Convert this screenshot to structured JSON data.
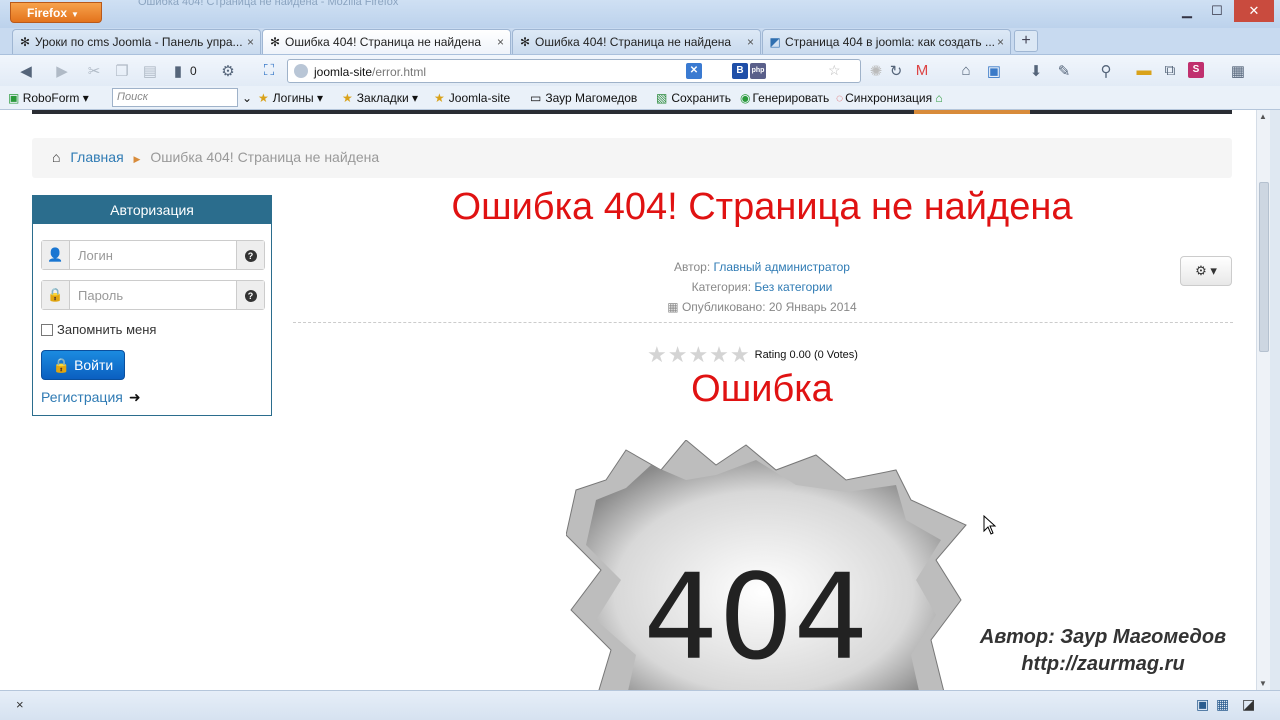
{
  "browser": {
    "menu_label": "Firefox",
    "ghost_title": "Ошибка 404! Страница не найдена - Mozilla Firefox",
    "tabs": [
      {
        "label": "Уроки по cms Joomla - Панель упра...",
        "active": false
      },
      {
        "label": "Ошибка 404! Страница не найдена",
        "active": true
      },
      {
        "label": "Ошибка 404! Страница не найдена",
        "active": false
      },
      {
        "label": "Страница 404 в joomla: как создать ...",
        "active": false
      }
    ],
    "new_tab": "+",
    "counter": "0",
    "url_host": "joomla-site",
    "url_path": "/error.html"
  },
  "bookmarks": {
    "roboform": "RoboForm",
    "search_placeholder": "Поиск",
    "items": [
      "Логины",
      "Закладки",
      "Joomla-site",
      "Заур Магомедов",
      "Сохранить",
      "Генерировать",
      "Синхронизация"
    ]
  },
  "page": {
    "breadcrumb": {
      "home": "Главная",
      "current": "Ошибка 404! Страница не найдена"
    },
    "login": {
      "header": "Авторизация",
      "username_placeholder": "Логин",
      "password_placeholder": "Пароль",
      "remember": "Запомнить меня",
      "submit": "Войти",
      "register": "Регистрация"
    },
    "article": {
      "title": "Ошибка 404! Страница не найдена",
      "author_label": "Автор:",
      "author": "Главный администратор",
      "category_label": "Категория:",
      "category": "Без категории",
      "published": "Опубликовано: 20 Январь 2014",
      "rating": "Rating 0.00 (0 Votes)",
      "subtitle": "Ошибка",
      "image_text": "404",
      "watermark_line1": "Автор: Заур Магомедов",
      "watermark_line2": "http://zaurmag.ru"
    }
  },
  "colors": {
    "accent_red": "#e01212",
    "login_header": "#2b6d8d",
    "link": "#2f7bb4",
    "button_blue": "#0b5fc0"
  }
}
